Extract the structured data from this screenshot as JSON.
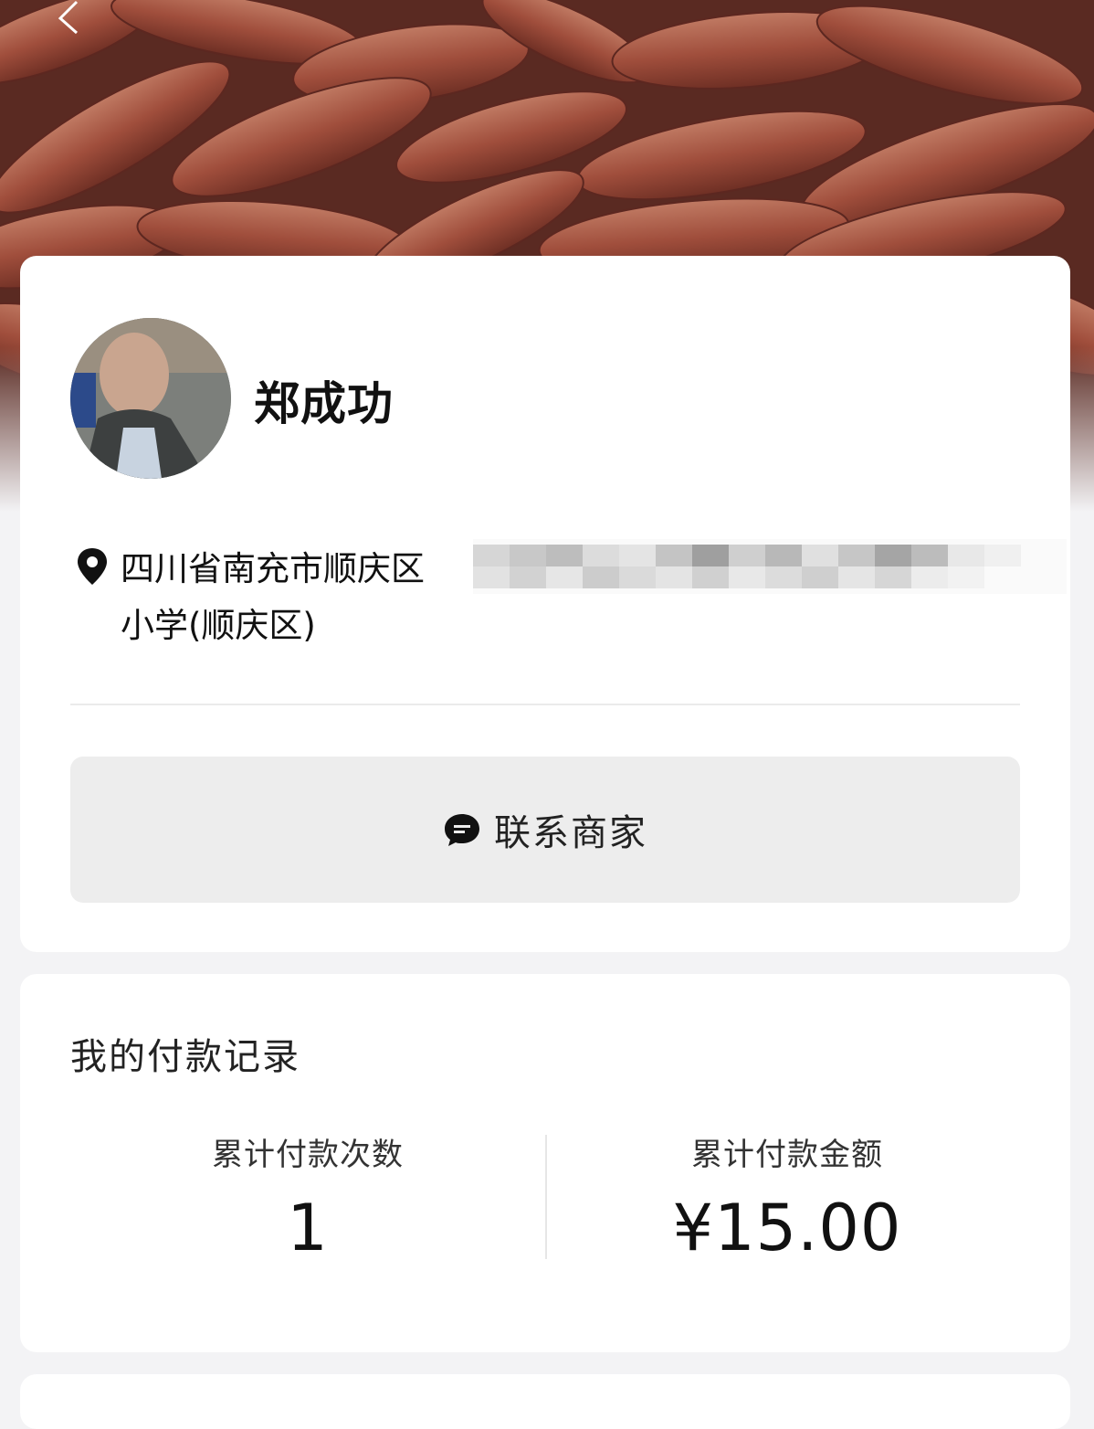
{
  "hero": {
    "image": "sweet-potatoes-photo"
  },
  "nav": {
    "back_icon": "chevron-left-icon"
  },
  "merchant": {
    "name": "郑成功",
    "avatar": "merchant-avatar-photo",
    "address_line1": "四川省南充市顺庆区",
    "address_line2": "小学(顺庆区)",
    "address_icon": "location-pin-icon"
  },
  "contact": {
    "label": "联系商家",
    "icon": "chat-bubble-icon"
  },
  "records": {
    "title": "我的付款记录",
    "count_label": "累计付款次数",
    "count_value": "1",
    "amount_label": "累计付款金额",
    "amount_value": "¥15.00"
  },
  "colors": {
    "background": "#f3f3f5",
    "card": "#ffffff",
    "button": "#ededed"
  }
}
